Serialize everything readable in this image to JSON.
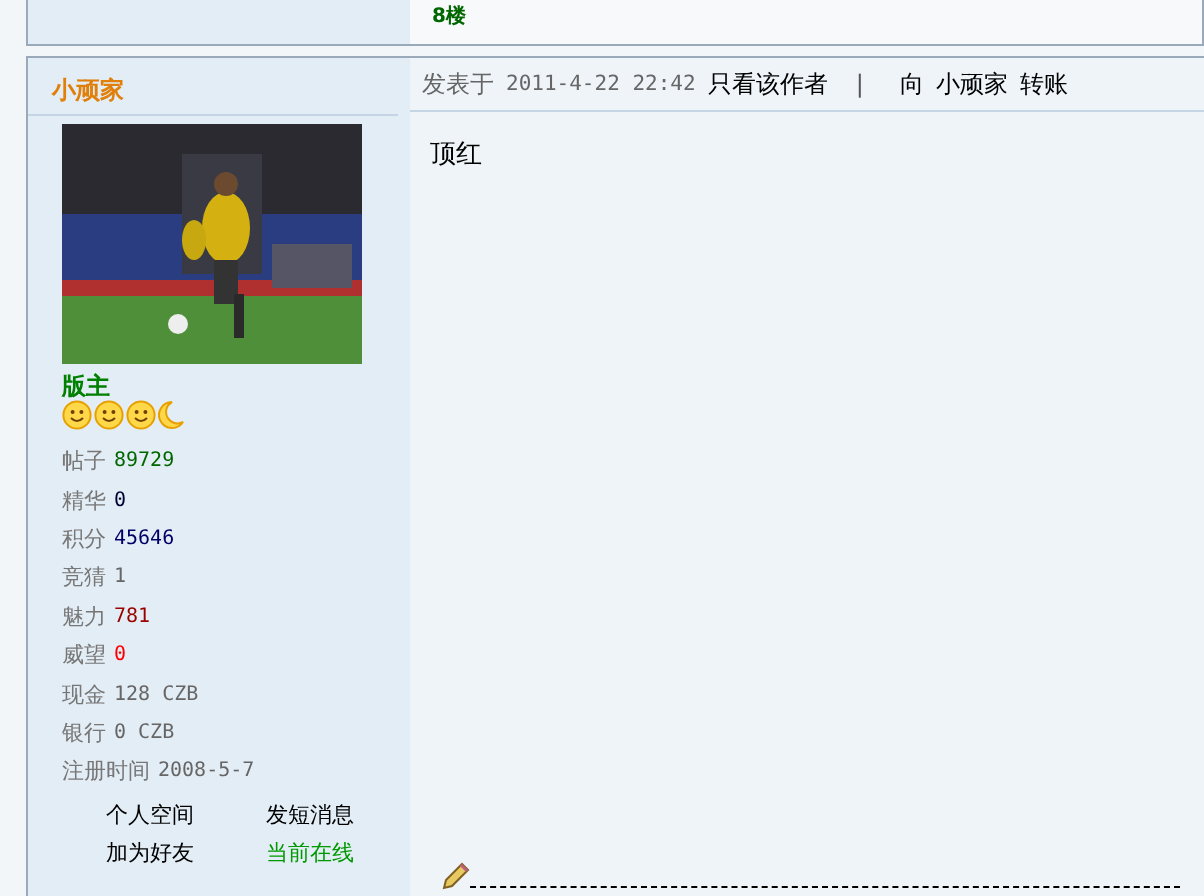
{
  "previous_post": {
    "floor": "8楼"
  },
  "post": {
    "author": "小顽家",
    "avatar": {
      "kind": "picture"
    },
    "rank": "版主",
    "rank_icons": [
      {
        "kind": "smiley"
      },
      {
        "kind": "smiley"
      },
      {
        "kind": "smiley"
      },
      {
        "kind": "moon"
      }
    ],
    "stats": [
      {
        "label": "帖子",
        "value": "89729",
        "color": "#006600"
      },
      {
        "label": "精华",
        "value": "0",
        "color": "#000033"
      },
      {
        "label": "积分",
        "value": "45646",
        "color": "#000066"
      },
      {
        "label": "竞猜",
        "value": "1",
        "color": "#666666"
      },
      {
        "label": "魅力",
        "value": "781",
        "color": "#990000"
      },
      {
        "label": "威望",
        "value": "0",
        "color": "#ff0000"
      },
      {
        "label": "现金",
        "value": "128 CZB",
        "color": "#666666"
      },
      {
        "label": "银行",
        "value": "0 CZB",
        "color": "#666666"
      },
      {
        "label": "注册时间",
        "value": "2008-5-7",
        "color": "#666666"
      }
    ],
    "links": [
      "个人空间",
      "发短消息",
      "加为好友"
    ],
    "online_status": {
      "label": "当前在线",
      "online": true
    },
    "header": {
      "posted_label": "发表于",
      "datetime": "2011-4-22 22:42",
      "author_only": "只看该作者",
      "separator": "|",
      "transfer_prefix": "向",
      "transfer_user": "小顽家",
      "transfer_suffix": "转账"
    },
    "content": "顶红"
  }
}
